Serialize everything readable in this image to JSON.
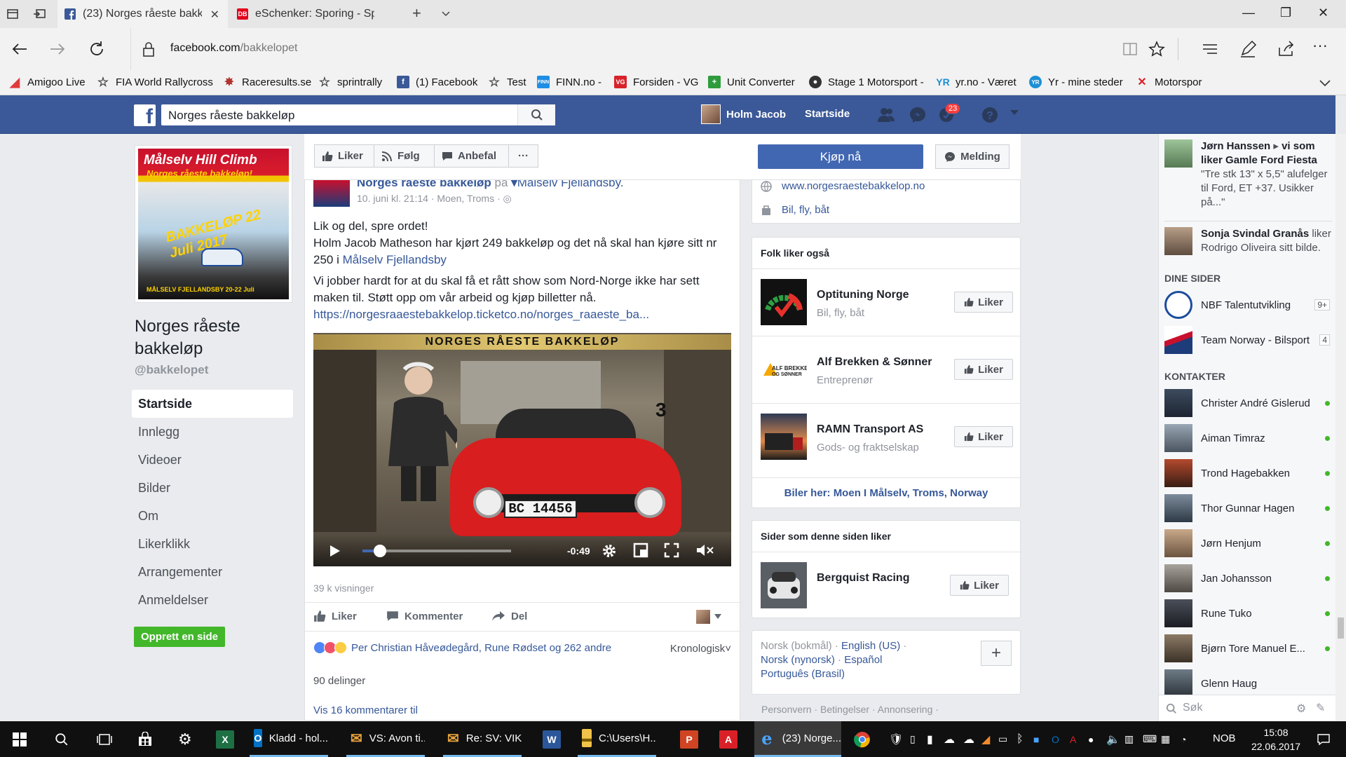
{
  "browser": {
    "tabs": [
      {
        "title": "(23) Norges råeste bakk",
        "active": true
      },
      {
        "title": "eSchenker: Sporing - Sporin",
        "active": false
      }
    ],
    "url_domain": "facebook.com",
    "url_path": "/bakkelopet",
    "favorites": [
      {
        "label": "Amigoo Live",
        "icon": "amigoo-icon",
        "color": "#e03a3a"
      },
      {
        "label": "FIA World Rallycross",
        "icon": "star-icon",
        "color": "#666666"
      },
      {
        "label": "Raceresults.se",
        "icon": "raceresults-icon",
        "color": "#b0332f"
      },
      {
        "label": "sprintrally",
        "icon": "star-icon",
        "color": "#666666"
      },
      {
        "label": "(1) Facebook",
        "icon": "facebook-icon",
        "color": "#3b5998"
      },
      {
        "label": "Test",
        "icon": "star-icon",
        "color": "#666666"
      },
      {
        "label": "FINN.no -",
        "icon": "finn-icon",
        "color": "#1e8ee6"
      },
      {
        "label": "Forsiden - VG",
        "icon": "vg-icon",
        "color": "#d8232a"
      },
      {
        "label": "Unit Converter",
        "icon": "unit-converter-icon",
        "color": "#2e9c3d"
      },
      {
        "label": "Stage 1 Motorsport -",
        "icon": "stage1-icon",
        "color": "#333333"
      },
      {
        "label": "yr.no - Været",
        "icon": "yr-icon",
        "color": "#1b8fd6"
      },
      {
        "label": "Yr - mine steder",
        "icon": "yr-icon",
        "color": "#1b8fd6"
      },
      {
        "label": "Motorspor",
        "icon": "motorsport-icon",
        "color": "#d8232a"
      }
    ]
  },
  "fb_header": {
    "search_value": "Norges råeste bakkeløp",
    "user_name": "Holm Jacob",
    "home_label": "Startside",
    "notification_count": "23",
    "brand_color": "#3b5998"
  },
  "page": {
    "cover_line1": "Målselv Hill Climb",
    "cover_line2": "Norges råeste bakkeløp!",
    "cover_line3": "BAKKELØP 22 Juli 2017",
    "cover_line4": "MÅLSELV FJELLANDSBY 20-22 Juli",
    "name": "Norges råeste bakkeløp",
    "handle": "@bakkelopet",
    "nav": [
      "Startside",
      "Innlegg",
      "Videoer",
      "Bilder",
      "Om",
      "Likerklikk",
      "Arrangementer",
      "Anmeldelser"
    ],
    "create_page": "Opprett en side"
  },
  "actionbar": {
    "like": "Liker",
    "follow": "Følg",
    "recommend": "Anbefal",
    "more": "···",
    "buy": "Kjøp nå",
    "message": "Melding"
  },
  "post": {
    "author": "Norges råeste bakkeløp",
    "at": "på",
    "location": "Målselv Fjellandsby.",
    "meta": "10. juni kl. 21:14 · Moen, Troms ·",
    "line1": "Lik og del, spre ordet!",
    "line2a": "Holm Jacob Matheson har kjørt 249 bakkeløp og det nå skal han kjøre sitt nr 250 i ",
    "line2_link": "Målselv Fjellandsby",
    "line3": "Vi jobber hardt for at du skal få et rått show som Nord-Norge ikke har sett maken til. Støtt opp om vår arbeid og kjøp billetter nå.",
    "link": "https://norgesraaestebakkelop.ticketco.no/norges_raaeste_ba...",
    "video": {
      "title": "NORGES RÅESTE BAKKELØP",
      "plate": "BC 14456",
      "number": "3",
      "time_remaining": "-0:49",
      "progress": 0.12
    },
    "views": "39 k visninger",
    "actions": {
      "like": "Liker",
      "comment": "Kommenter",
      "share": "Del"
    },
    "reactions_text": "Per Christian Håveødegård, Rune Rødset og 262 andre",
    "order": "Kronologisk",
    "shares": "90 delinger",
    "comments_link": "Vis 16 kommentarer til"
  },
  "about": {
    "website": "www.norgesraestebakkelop.no",
    "category": "Bil, fly, båt"
  },
  "people_also_like": {
    "title": "Folk liker også",
    "items": [
      {
        "name": "Optituning Norge",
        "category": "Bil, fly, båt",
        "button": "Liker"
      },
      {
        "name": "Alf Brekken & Sønner",
        "category": "Entreprenør",
        "button": "Liker"
      },
      {
        "name": "RAMN Transport AS",
        "category": "Gods- og fraktselskap",
        "button": "Liker"
      }
    ],
    "cars_here": "Biler her: Moen I Målselv, Troms, Norway"
  },
  "pages_liked": {
    "title": "Sider som denne siden liker",
    "items": [
      {
        "name": "Bergquist Racing",
        "button": "Liker"
      }
    ]
  },
  "languages": {
    "current": "Norsk (bokmål)",
    "others": [
      "English (US)",
      "Norsk (nynorsk)",
      "Español",
      "Português (Brasil)"
    ],
    "add": "+"
  },
  "footer_links": "Personvern · Betingelser · Annonsering ·",
  "ticker": [
    {
      "actor": "Jørn Hanssen",
      "text": "vi som liker Gamle Ford Fiesta",
      "quote": "\"Tre stk 13\" x 5,5\" alufelger til Ford, ET +37. Usikker på...\""
    },
    {
      "actor": "Sonja Svindal Granås",
      "text": "liker Rodrigo Oliveira sitt bilde."
    }
  ],
  "your_pages": {
    "title": "DINE SIDER",
    "items": [
      {
        "name": "NBF Talentutvikling",
        "count": "9+"
      },
      {
        "name": "Team Norway - Bilsport",
        "count": "4"
      }
    ]
  },
  "contacts": {
    "title": "KONTAKTER",
    "items": [
      "Christer André Gislerud",
      "Aiman Timraz",
      "Trond Hagebakken",
      "Thor Gunnar Hagen",
      "Jørn Henjum",
      "Jan Johansson",
      "Rune Tuko",
      "Bjørn Tore Manuel E...",
      "Glenn Haug"
    ],
    "search_placeholder": "Søk"
  },
  "taskbar": {
    "apps": [
      {
        "label": "Kladd - hol...",
        "icon": "outlook-icon",
        "color": "#0072c6",
        "glyph": "O"
      },
      {
        "label": "VS: Avon ti...",
        "icon": "mail-icon",
        "color": "#e8a33c",
        "glyph": "✉"
      },
      {
        "label": "Re: SV: VIK...",
        "icon": "mail-icon",
        "color": "#e8a33c",
        "glyph": "✉"
      },
      {
        "label": "C:\\Users\\H...",
        "icon": "folder-icon",
        "color": "#f1c34a",
        "glyph": "▬"
      },
      {
        "label": "(23) Norge...",
        "icon": "edge-icon",
        "color": "#1e7ad6",
        "glyph": "e"
      }
    ],
    "language": "NOB",
    "time": "15:08",
    "date": "22.06.2017"
  }
}
